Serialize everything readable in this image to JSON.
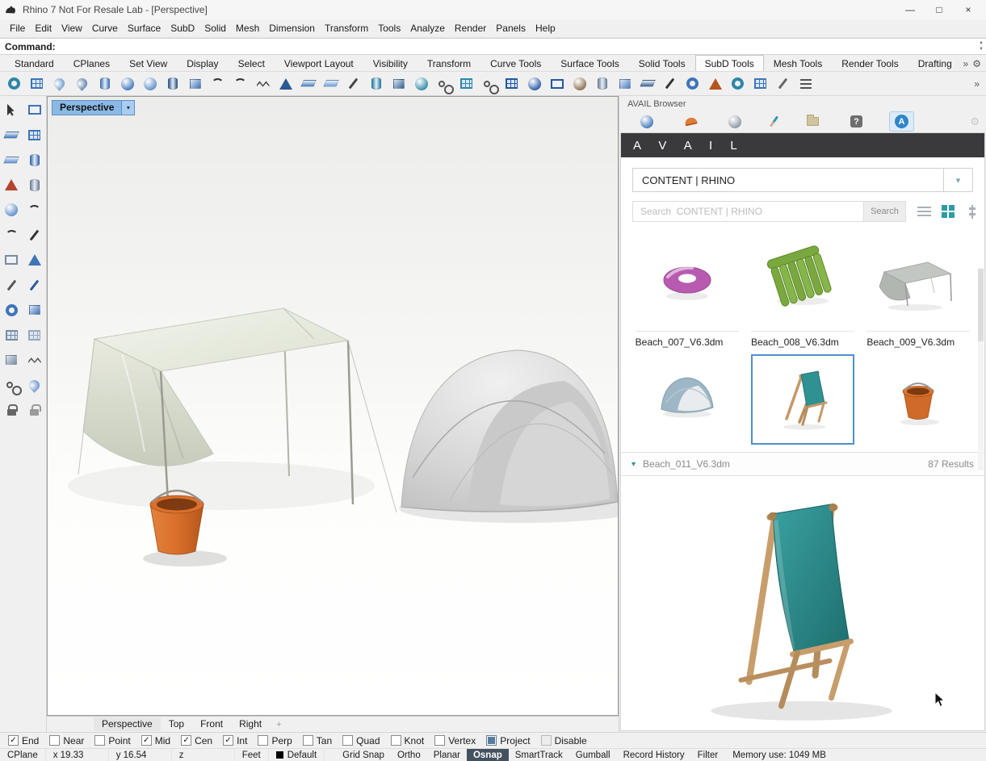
{
  "window": {
    "title": "Rhino 7 Not For Resale Lab - [Perspective]"
  },
  "glyphs": {
    "minimize": "—",
    "maximize": "□",
    "close": "×",
    "overflow": "»",
    "gear": "⚙",
    "dropdown": "▾",
    "spin_up": "▲",
    "spin_down": "▼",
    "help": "?",
    "avail_a": "A",
    "new_tab": "+",
    "collapse": "▾"
  },
  "colors": {
    "accent": "#4f8fd0",
    "selection": "#4f8fd0",
    "avail_banner": "#3a3a3c",
    "teal": "#2e8f8f",
    "status_active": "#44515f",
    "viewport_tab": "#8bb9e6"
  },
  "menu_items": [
    "File",
    "Edit",
    "View",
    "Curve",
    "Surface",
    "SubD",
    "Solid",
    "Mesh",
    "Dimension",
    "Transform",
    "Tools",
    "Analyze",
    "Render",
    "Panels",
    "Help"
  ],
  "command": {
    "prompt": "Command:"
  },
  "toolbar_tabs": [
    {
      "label": "Standard"
    },
    {
      "label": "CPlanes"
    },
    {
      "label": "Set View"
    },
    {
      "label": "Display"
    },
    {
      "label": "Select"
    },
    {
      "label": "Viewport Layout"
    },
    {
      "label": "Visibility"
    },
    {
      "label": "Transform"
    },
    {
      "label": "Curve Tools"
    },
    {
      "label": "Surface Tools"
    },
    {
      "label": "Solid Tools"
    },
    {
      "label": "SubD Tools",
      "active": true
    },
    {
      "label": "Mesh Tools"
    },
    {
      "label": "Render Tools"
    },
    {
      "label": "Drafting"
    }
  ],
  "top_toolbar_icons": [
    {
      "name": "torus-icon",
      "shape": "ring",
      "color": "#2e86a8"
    },
    {
      "name": "plane-grid-icon",
      "shape": "grid",
      "color": "#3e74b8"
    },
    {
      "name": "drop-icon",
      "shape": "drop",
      "color": "#4a7fc0"
    },
    {
      "name": "drop-solid-icon",
      "shape": "drop",
      "color": "#2b5a94"
    },
    {
      "name": "cylinder-icon",
      "shape": "cyl",
      "color": "#4a7fc0"
    },
    {
      "name": "sphere-icon",
      "shape": "sphere",
      "color": "#3e74b8"
    },
    {
      "name": "ellipsoid-icon",
      "shape": "sphere",
      "color": "#5b8cc8"
    },
    {
      "name": "disc-icon",
      "shape": "cyl",
      "color": "#35618f"
    },
    {
      "name": "rounded-box-icon",
      "shape": "box",
      "color": "#3e74b8"
    },
    {
      "name": "arc-one-icon",
      "shape": "arc",
      "color": "#333333"
    },
    {
      "name": "arc-two-icon",
      "shape": "arc",
      "color": "#333333"
    },
    {
      "name": "zigzag-curve-icon",
      "shape": "zig",
      "color": "#444444"
    },
    {
      "name": "fin-icon",
      "shape": "cone",
      "color": "#2b5a94"
    },
    {
      "name": "wedge-icon",
      "shape": "plane",
      "color": "#4a7fc0"
    },
    {
      "name": "swept-surface-icon",
      "shape": "plane",
      "color": "#6aa0d8"
    },
    {
      "name": "corner-pen-icon",
      "shape": "pen",
      "color": "#444444"
    },
    {
      "name": "pipe-icon",
      "shape": "cyl",
      "color": "#2e86a8"
    },
    {
      "name": "solid-box-icon",
      "shape": "box",
      "color": "#35618f"
    },
    {
      "name": "control-sphere-icon",
      "shape": "sphere",
      "color": "#2e86a8"
    },
    {
      "name": "chain-edge-icon",
      "shape": "chain",
      "color": "#555555"
    },
    {
      "name": "quad-mesh-icon",
      "shape": "grid",
      "color": "#2e86a8"
    },
    {
      "name": "link-icon",
      "shape": "chain",
      "color": "#555555"
    },
    {
      "name": "mesh-plane-icon",
      "shape": "grid",
      "color": "#2456a0"
    },
    {
      "name": "mesh-sphere-icon",
      "shape": "sphere",
      "color": "#2456a0"
    },
    {
      "name": "picture-frame-icon",
      "shape": "frame",
      "color": "#2456a0"
    },
    {
      "name": "teapot-icon",
      "shape": "sphere",
      "color": "#8a6a4a"
    },
    {
      "name": "faucet-icon",
      "shape": "cyl",
      "color": "#7a8ba0"
    },
    {
      "name": "count-icon",
      "shape": "box",
      "color": "#4a7fc0"
    },
    {
      "name": "slab-icon",
      "shape": "plane",
      "color": "#35618f"
    },
    {
      "name": "marker-pen-icon",
      "shape": "pen",
      "color": "#333333"
    },
    {
      "name": "torus-section-icon",
      "shape": "ring",
      "color": "#3e74b8"
    },
    {
      "name": "paint-bucket-icon",
      "shape": "cone",
      "color": "#b5541c"
    },
    {
      "name": "spiral-icon",
      "shape": "ring",
      "color": "#2e86a8"
    },
    {
      "name": "mesh-grid-icon",
      "shape": "grid",
      "color": "#3e74b8"
    },
    {
      "name": "wrench-icon",
      "shape": "pen",
      "color": "#666666"
    },
    {
      "name": "stack-list-icon",
      "shape": "bars",
      "color": "#555555"
    }
  ],
  "left_toolbar_icons": [
    {
      "name": "select-cursor-icon",
      "shape": "cursor",
      "color": "#222222"
    },
    {
      "name": "drafting-board-icon",
      "shape": "frame",
      "color": "#3e74b8"
    },
    {
      "name": "surface-pair-icon",
      "shape": "plane",
      "color": "#3e74b8"
    },
    {
      "name": "checker-surface-icon",
      "shape": "grid",
      "color": "#3e74b8"
    },
    {
      "name": "open-book-icon",
      "shape": "plane",
      "color": "#5b8cc8"
    },
    {
      "name": "cylinder-solid-icon",
      "shape": "cyl",
      "color": "#3e74b8"
    },
    {
      "name": "paint-bucket-icon",
      "shape": "cone",
      "color": "#b5442c"
    },
    {
      "name": "mug-icon",
      "shape": "cyl",
      "color": "#7a8ba0"
    },
    {
      "name": "jug-icon",
      "shape": "sphere",
      "color": "#5b8cc8"
    },
    {
      "name": "hook-curve-icon",
      "shape": "arc",
      "color": "#333333"
    },
    {
      "name": "curve-icon",
      "shape": "arc",
      "color": "#333333"
    },
    {
      "name": "control-pen-icon",
      "shape": "pen",
      "color": "#333333"
    },
    {
      "name": "clipboard-icon",
      "shape": "frame",
      "color": "#7a8ba0"
    },
    {
      "name": "flag-icon",
      "shape": "cone",
      "color": "#3e74b8"
    },
    {
      "name": "divider-caliper-icon",
      "shape": "pen",
      "color": "#555555"
    },
    {
      "name": "marker-icon",
      "shape": "pen",
      "color": "#2b5a94"
    },
    {
      "name": "circle-array-icon",
      "shape": "ring",
      "color": "#3e74b8"
    },
    {
      "name": "block-pair-icon",
      "shape": "box",
      "color": "#3e74b8"
    },
    {
      "name": "grid-array-icon",
      "shape": "grid",
      "color": "#7a8ba0"
    },
    {
      "name": "dot-array-icon",
      "shape": "grid",
      "color": "#9aa8b8"
    },
    {
      "name": "stairs-icon",
      "shape": "box",
      "color": "#7a8ba0"
    },
    {
      "name": "helix-icon",
      "shape": "zig",
      "color": "#555555"
    },
    {
      "name": "magnet-icon",
      "shape": "chain",
      "color": "#555555"
    },
    {
      "name": "gem-icon",
      "shape": "drop",
      "color": "#3e74b8"
    },
    {
      "name": "lock-icon",
      "shape": "lock",
      "color": "#666666"
    },
    {
      "name": "unlock-icon",
      "shape": "lock",
      "color": "#9a9a9a"
    }
  ],
  "viewport": {
    "title": "Perspective",
    "page_tabs": [
      {
        "label": "Perspective",
        "active": true
      },
      {
        "label": "Top"
      },
      {
        "label": "Front"
      },
      {
        "label": "Right"
      }
    ]
  },
  "avail": {
    "panel_label": "AVAIL Browser",
    "brand": "A V A I L",
    "source": "CONTENT | RHINO",
    "search_placeholder": "Search  CONTENT | RHINO",
    "search_button": "Search",
    "tiles": [
      {
        "label": "Beach_007_V6.3dm"
      },
      {
        "label": "Beach_008_V6.3dm"
      },
      {
        "label": "Beach_009_V6.3dm"
      },
      {
        "label": ""
      },
      {
        "label": "",
        "selected": true
      },
      {
        "label": ""
      }
    ],
    "detail_file": "Beach_011_V6.3dm",
    "results_count": "87 Results"
  },
  "osnap_items": [
    {
      "label": "End",
      "checked": true
    },
    {
      "label": "Near",
      "checked": false
    },
    {
      "label": "Point",
      "checked": false
    },
    {
      "label": "Mid",
      "checked": true
    },
    {
      "label": "Cen",
      "checked": true
    },
    {
      "label": "Int",
      "checked": true
    },
    {
      "label": "Perp",
      "checked": false
    },
    {
      "label": "Tan",
      "checked": false
    },
    {
      "label": "Quad",
      "checked": false
    },
    {
      "label": "Knot",
      "checked": false
    },
    {
      "label": "Vertex",
      "checked": false
    },
    {
      "label": "Project",
      "checked": false,
      "filled": true
    },
    {
      "label": "Disable",
      "checked": false,
      "muted": true
    }
  ],
  "status": {
    "cplane": "CPlane",
    "coord_x": "x 19.33",
    "coord_y": "y 16.54",
    "coord_z": "z",
    "units": "Feet",
    "layer": "Default",
    "toggles": [
      {
        "label": "Grid Snap"
      },
      {
        "label": "Ortho"
      },
      {
        "label": "Planar"
      },
      {
        "label": "Osnap",
        "active": true
      },
      {
        "label": "SmartTrack"
      },
      {
        "label": "Gumball"
      },
      {
        "label": "Record History"
      },
      {
        "label": "Filter"
      }
    ],
    "memory": "Memory use: 1049 MB"
  }
}
